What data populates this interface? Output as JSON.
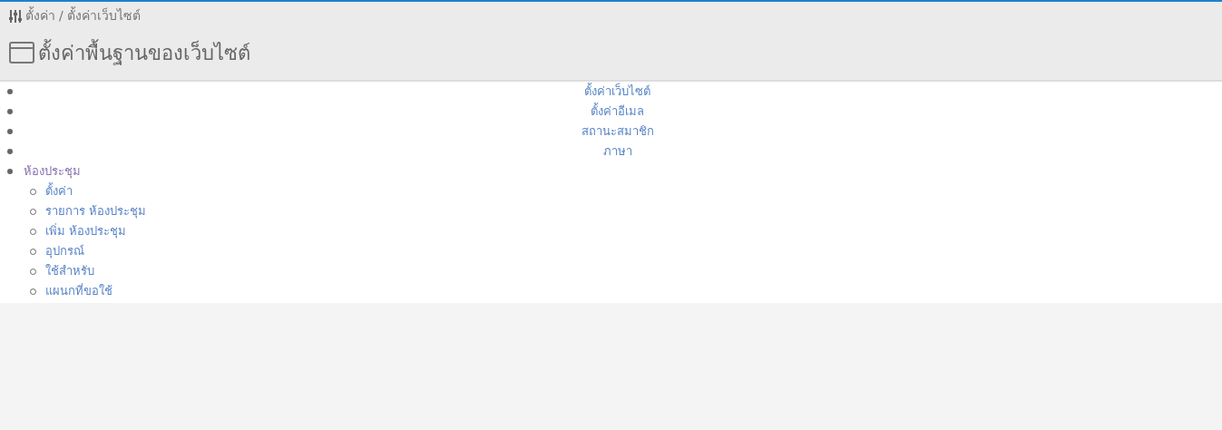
{
  "breadcrumb": [
    "ตั้งค่า",
    "/",
    "ตั้งค่าเว็บไซต์"
  ],
  "title": "ตั้งค่าพื้นฐานของเว็บไซต์",
  "menu": [
    {
      "label": "ตั้งค่าเว็บไซต์"
    },
    {
      "label": "ตั้งค่าอีเมล"
    },
    {
      "label": "สถานะสมาชิก"
    },
    {
      "label": "ภาษา"
    },
    {
      "label": "ห้องประชุม",
      "children": [
        {
          "label": "ตั้งค่า"
        },
        {
          "label": "รายการ ห้องประชุม"
        },
        {
          "label": "เพิ่ม ห้องประชุม"
        },
        {
          "label": "อุปกรณ์"
        },
        {
          "label": "ใช้สำหรับ"
        },
        {
          "label": "แผนกที่ขอใช้"
        }
      ]
    }
  ]
}
